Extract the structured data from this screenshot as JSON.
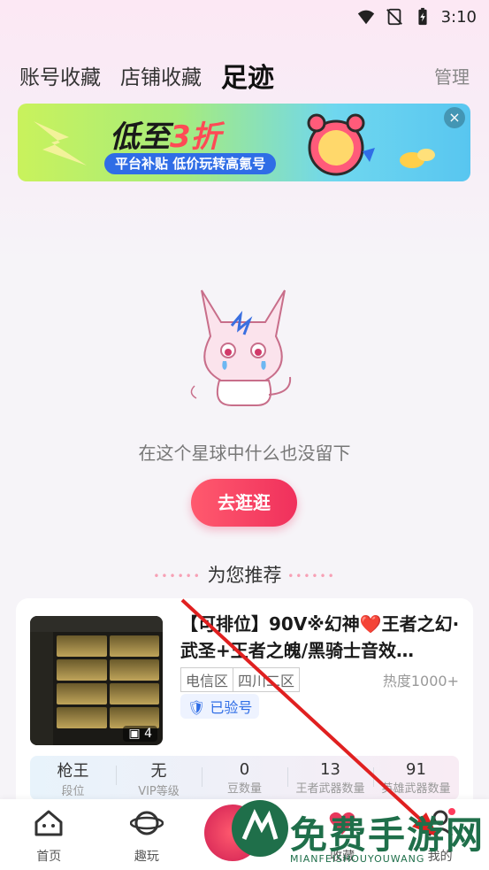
{
  "status_bar": {
    "time": "3:10",
    "icons": [
      "wifi-icon",
      "no-sim-icon",
      "battery-icon"
    ]
  },
  "tabs": [
    {
      "label": "账号收藏"
    },
    {
      "label": "店铺收藏"
    },
    {
      "label": "足迹"
    }
  ],
  "manage_label": "管理",
  "banner": {
    "title_prefix": "低至",
    "title_big": "3折",
    "subtitle": "平台补贴 低价玩转高氪号",
    "close": "×"
  },
  "empty_state": {
    "text": "在这个星球中什么也没留下",
    "button": "去逛逛"
  },
  "recommend": {
    "title": "为您推荐",
    "dots": "••••••"
  },
  "card": {
    "title": "【可排位】90V※幻神❤️王者之幻·武圣+王者之魄/黑骑士音效…",
    "tags": [
      "电信区",
      "四川二区"
    ],
    "heat": "热度1000+",
    "verified": "已验号",
    "image_count": "4",
    "stats": [
      {
        "value": "枪王",
        "label": "段位"
      },
      {
        "value": "无",
        "label": "VIP等级"
      },
      {
        "value": "0",
        "label": "豆数量"
      },
      {
        "value": "13",
        "label": "王者武器数量"
      },
      {
        "value": "91",
        "label": "英雄武器数量"
      }
    ]
  },
  "bottom_nav": [
    {
      "label": "首页",
      "icon": "home-icon"
    },
    {
      "label": "趣玩",
      "icon": "planet-icon"
    },
    {
      "label": "",
      "icon": "center-icon"
    },
    {
      "label": "收藏",
      "icon": "heart-icon"
    },
    {
      "label": "我的",
      "icon": "user-icon"
    }
  ],
  "watermark": {
    "text": "免费手游网",
    "sub": "MIANFEISHOUYOUWANG"
  }
}
